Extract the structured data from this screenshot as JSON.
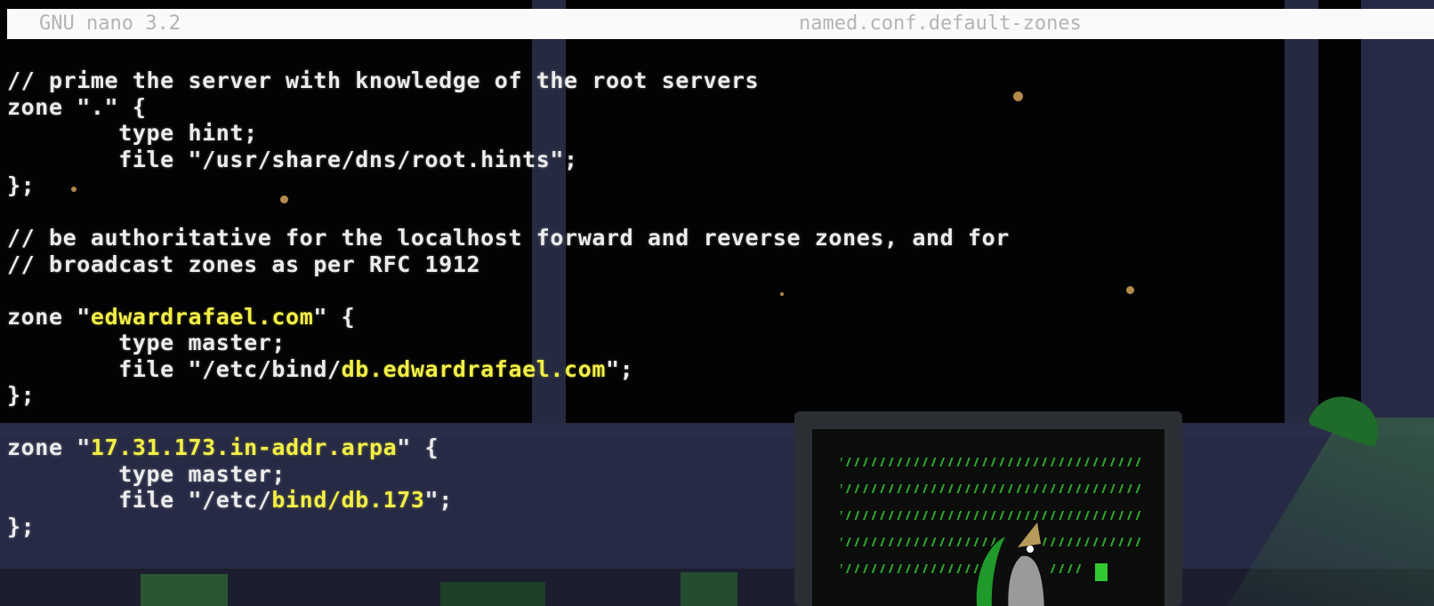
{
  "titlebar": {
    "app_name": "GNU nano 3.2",
    "file_name": "named.conf.default-zones"
  },
  "editor": {
    "lines": [
      {
        "parts": [
          {
            "t": "// prime the server with knowledge of the root servers"
          }
        ]
      },
      {
        "parts": [
          {
            "t": "zone \".\" {"
          }
        ]
      },
      {
        "parts": [
          {
            "t": "        type hint;"
          }
        ]
      },
      {
        "parts": [
          {
            "t": "        file \"/usr/share/dns/root.hints\";"
          }
        ]
      },
      {
        "parts": [
          {
            "t": "};"
          }
        ]
      },
      {
        "parts": [
          {
            "t": ""
          }
        ]
      },
      {
        "parts": [
          {
            "t": "// be authoritative for the localhost forward and reverse zones, and for"
          }
        ]
      },
      {
        "parts": [
          {
            "t": "// broadcast zones as per RFC 1912"
          }
        ]
      },
      {
        "parts": [
          {
            "t": ""
          }
        ]
      },
      {
        "parts": [
          {
            "t": "zone \""
          },
          {
            "t": "edwardrafael.com",
            "hl": true
          },
          {
            "t": "\" {"
          }
        ]
      },
      {
        "parts": [
          {
            "t": "        type master;"
          }
        ]
      },
      {
        "parts": [
          {
            "t": "        file \"/etc/bind/"
          },
          {
            "t": "db.edwardrafael.com",
            "hl": true
          },
          {
            "t": "\";"
          }
        ]
      },
      {
        "parts": [
          {
            "t": "};"
          }
        ]
      },
      {
        "parts": [
          {
            "t": ""
          }
        ]
      },
      {
        "parts": [
          {
            "t": "zone \""
          },
          {
            "t": "17.31.173.in-addr.arpa",
            "hl": true
          },
          {
            "t": "\" {"
          }
        ]
      },
      {
        "parts": [
          {
            "t": "        type master;"
          }
        ]
      },
      {
        "parts": [
          {
            "t": "        file \"/etc/"
          },
          {
            "t": "bind/db.173",
            "hl": true
          },
          {
            "t": "\";"
          }
        ]
      },
      {
        "parts": [
          {
            "t": "};"
          }
        ]
      }
    ]
  },
  "colors": {
    "text": "#ececec",
    "highlight": "#f3ef48",
    "titlebar_bg": "#fafafa",
    "titlebar_text": "#b4b4b4",
    "screen_green": "#32c832"
  },
  "icons": {
    "wallpaper_mascot": "penguin-icon",
    "wallpaper_lamp": "desk-lamp-icon"
  }
}
